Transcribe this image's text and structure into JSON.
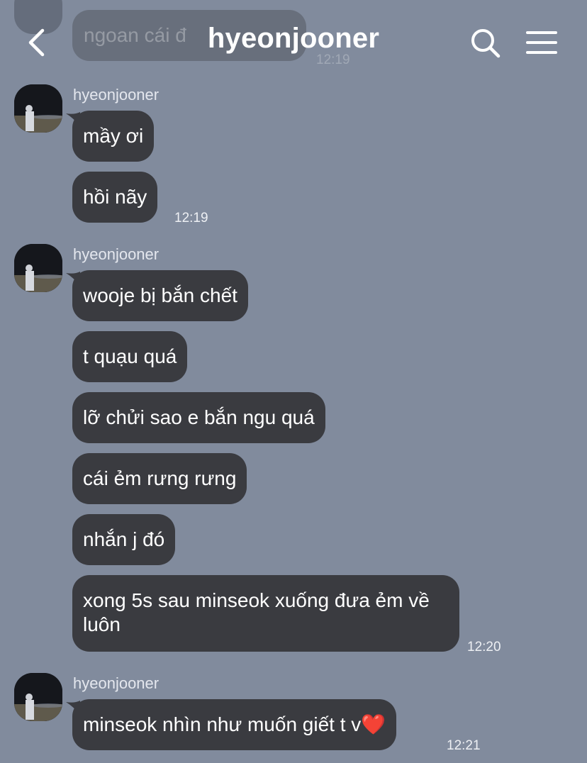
{
  "header": {
    "title": "hyeonjooner",
    "back_icon": "chevron-left-icon",
    "search_icon": "search-icon",
    "menu_icon": "menu-icon"
  },
  "peek_message": {
    "text": "ngoan cái đ",
    "time": "12:19"
  },
  "groups": [
    {
      "sender": "hyeonjooner",
      "messages": [
        {
          "text": "mầy ơi"
        },
        {
          "text": "hồi nãy"
        }
      ],
      "time": "12:19"
    },
    {
      "sender": "hyeonjooner",
      "messages": [
        {
          "text": "wooje bị bắn chết"
        },
        {
          "text": "t quạu quá"
        },
        {
          "text": "lỡ chửi sao e bắn ngu quá"
        },
        {
          "text": "cái ẻm rưng rưng"
        },
        {
          "text": "nhắn j đó"
        },
        {
          "text": "xong 5s sau minseok xuống đưa ẻm về luôn"
        }
      ],
      "time": "12:20"
    },
    {
      "sender": "hyeonjooner",
      "messages": [
        {
          "text": "minseok nhìn như muốn giết t v❤️"
        }
      ],
      "time": "12:21"
    }
  ],
  "colors": {
    "background": "#818b9d",
    "bubble": "#3a3b40",
    "text": "#ffffff"
  }
}
